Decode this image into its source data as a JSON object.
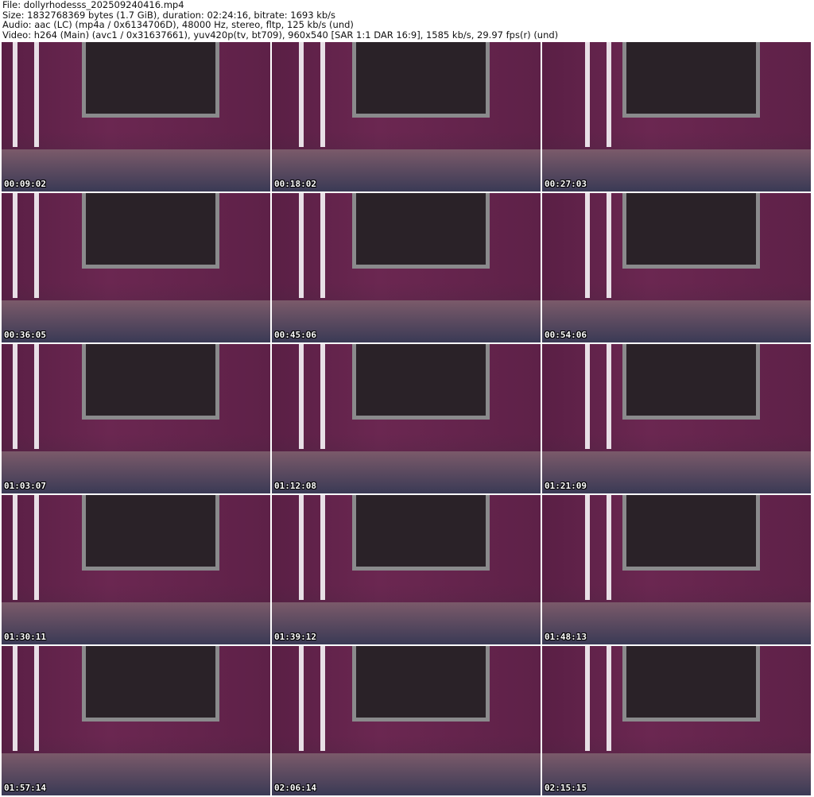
{
  "header": {
    "file": "File: dollyrhodesss_202509240416.mp4",
    "size": "Size: 1832768369 bytes (1.7 GiB), duration: 02:24:16, bitrate: 1693 kb/s",
    "audio": "Audio: aac (LC) (mp4a / 0x6134706D), 48000 Hz, stereo, fltp, 125 kb/s (und)",
    "video": "Video: h264 (Main) (avc1 / 0x31637661), yuv420p(tv, bt709), 960x540 [SAR 1:1 DAR 16:9], 1585 kb/s, 29.97 fps(r) (und)"
  },
  "thumbnails": [
    {
      "timestamp": "00:09:02"
    },
    {
      "timestamp": "00:18:02"
    },
    {
      "timestamp": "00:27:03"
    },
    {
      "timestamp": "00:36:05"
    },
    {
      "timestamp": "00:45:06"
    },
    {
      "timestamp": "00:54:06"
    },
    {
      "timestamp": "01:03:07"
    },
    {
      "timestamp": "01:12:08"
    },
    {
      "timestamp": "01:21:09"
    },
    {
      "timestamp": "01:30:11"
    },
    {
      "timestamp": "01:39:12"
    },
    {
      "timestamp": "01:48:13"
    },
    {
      "timestamp": "01:57:14"
    },
    {
      "timestamp": "02:06:14"
    },
    {
      "timestamp": "02:15:15"
    }
  ]
}
